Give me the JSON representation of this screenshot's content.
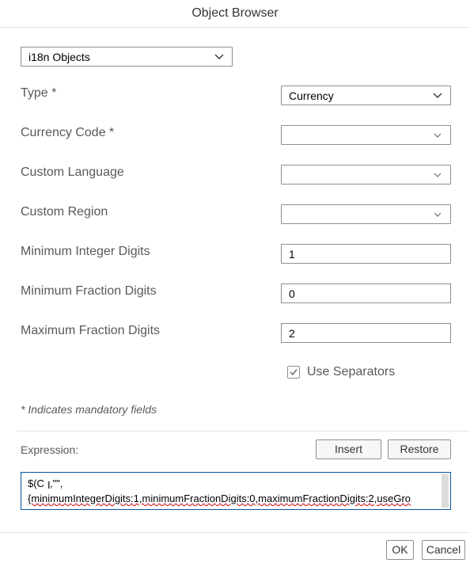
{
  "dialog": {
    "title": "Object Browser"
  },
  "object_type_select": {
    "value": "i18n Objects",
    "icon": "chevron-down-icon"
  },
  "form": {
    "type": {
      "label": "Type *",
      "value": "Currency"
    },
    "currency_code": {
      "label": "Currency Code *",
      "value": ""
    },
    "custom_language": {
      "label": "Custom Language",
      "value": ""
    },
    "custom_region": {
      "label": "Custom Region",
      "value": ""
    },
    "min_integer_digits": {
      "label": "Minimum Integer Digits",
      "value": "1"
    },
    "min_fraction_digits": {
      "label": "Minimum Fraction Digits",
      "value": "0"
    },
    "max_fraction_digits": {
      "label": "Maximum Fraction Digits",
      "value": "2"
    },
    "use_separators": {
      "label": "Use Separators",
      "checked": true
    }
  },
  "mandatory_note": "* Indicates mandatory fields",
  "expression": {
    "label": "Expression:",
    "line1_prefix": "$(C",
    "line1_suffix": ",\"\",",
    "line2": "{minimumIntegerDigits:1,minimumFractionDigits:0,maximumFractionDigits:2,useGro",
    "insert_label": "Insert",
    "restore_label": "Restore"
  },
  "footer": {
    "ok_label": "OK",
    "cancel_label": "Cancel"
  },
  "colors": {
    "border": "#89919a",
    "focus": "#0854a0",
    "label": "#595959",
    "divider": "#e5e5e5"
  }
}
